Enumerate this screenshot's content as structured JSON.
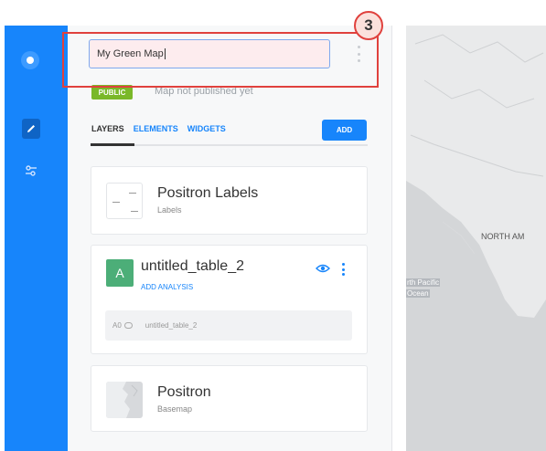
{
  "header": {
    "map_title": "My Green Map",
    "privacy_badge": "PUBLIC",
    "publish_status": "Map not published yet"
  },
  "tabs": [
    {
      "label": "LAYERS",
      "active": true
    },
    {
      "label": "ELEMENTS",
      "active": false
    },
    {
      "label": "WIDGETS",
      "active": false
    }
  ],
  "add_button": "ADD",
  "layers": [
    {
      "title": "Positron Labels",
      "subtitle": "Labels",
      "icon": "labels-thumbnail-icon"
    },
    {
      "letter": "A",
      "title": "untitled_table_2",
      "action": "ADD ANALYSIS",
      "source_node": "A0",
      "source_name": "untitled_table_2",
      "icon": "dataset-icon"
    },
    {
      "title": "Positron",
      "subtitle": "Basemap",
      "icon": "basemap-thumbnail-icon"
    }
  ],
  "map": {
    "label_continent": "NORTH AM",
    "label_ocean_line1": "rth Pacific",
    "label_ocean_line2": "Ocean"
  },
  "annotation": {
    "step": "3"
  },
  "colors": {
    "rail": "#1785fb",
    "accent": "#1785fb",
    "public": "#7ab829",
    "dataset": "#4cae78",
    "highlight": "#e0413d"
  }
}
